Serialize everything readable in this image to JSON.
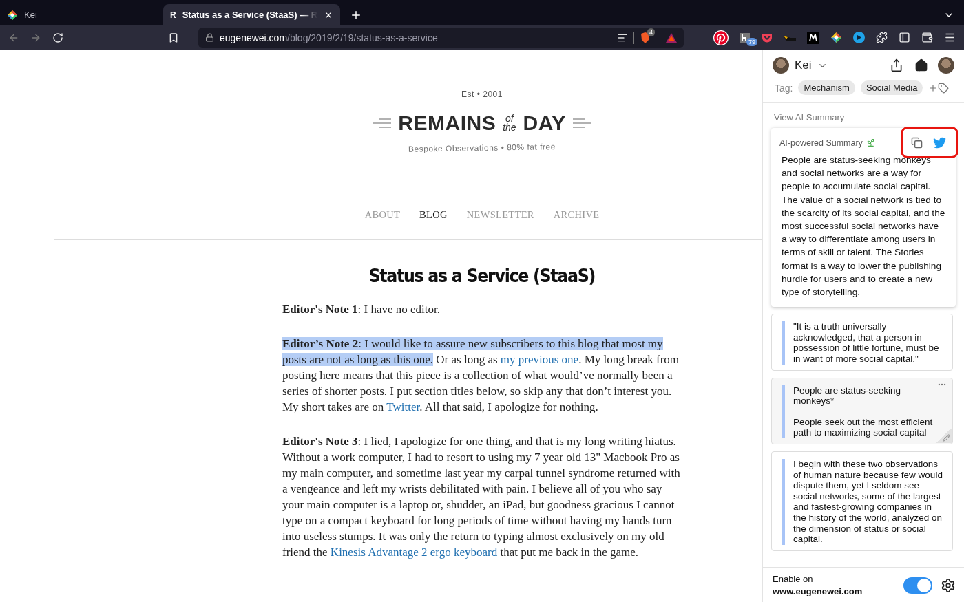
{
  "browser": {
    "tabs": [
      {
        "label": "Kei",
        "selected": false,
        "kind": "app"
      },
      {
        "label": "Status as a Service (StaaS) — R",
        "selected": true,
        "kind": "site",
        "favicon": "R"
      }
    ],
    "url": {
      "host": "eugenewei.com",
      "path": "/blog/2019/2/19/status-as-a-service"
    },
    "brave_badge": "4",
    "extension_badge": "79"
  },
  "site": {
    "established": "Est • 2001",
    "logo": {
      "word1": "REMAINS",
      "small_top": "of",
      "small_bottom": "the",
      "word2": "DAY"
    },
    "tagline": "Bespoke Observations • 80% fat free",
    "nav": [
      {
        "label": "ABOUT",
        "selected": false
      },
      {
        "label": "BLOG",
        "selected": true
      },
      {
        "label": "NEWSLETTER",
        "selected": false
      },
      {
        "label": "ARCHIVE",
        "selected": false
      }
    ]
  },
  "article": {
    "title": "Status as a Service (StaaS)",
    "paragraphs": [
      [
        {
          "kind": "bold",
          "text": "Editor's Note 1"
        },
        {
          "kind": "plain",
          "text": ": I have no editor."
        }
      ],
      [
        {
          "kind": "bold_highlight",
          "text": "Editor’s Note 2"
        },
        {
          "kind": "highlight",
          "text": ": I would like to assure new subscribers to this blog that most my posts are not as long as this one."
        },
        {
          "kind": "plain",
          "text": " Or as long as "
        },
        {
          "kind": "link",
          "text": "my previous one"
        },
        {
          "kind": "plain",
          "text": ". My long break from posting here means that this piece is a collection of what would’ve normally been a series of shorter posts. I put section titles below, so skip any that don’t interest you. My short takes are on "
        },
        {
          "kind": "link",
          "text": "Twitter"
        },
        {
          "kind": "plain",
          "text": ". All that said, I apologize for nothing."
        }
      ],
      [
        {
          "kind": "bold",
          "text": "Editor's Note 3"
        },
        {
          "kind": "plain",
          "text": ": I lied, I apologize for one thing, and that is my long writing hiatus. Without a work computer, I had to resort to using my 7 year old 13\" Macbook Pro as my main computer, and sometime last year my carpal tunnel syndrome returned with a vengeance and left my wrists debilitated with pain. I believe all of you who say your main computer is a laptop or, shudder, an iPad, but goodness gracious I cannot type on a compact keyboard for long periods of time without having my hands turn into useless stumps. It was only the return to typing almost exclusively on my old friend the "
        },
        {
          "kind": "link",
          "text": "Kinesis Advantage 2 ergo keyboard"
        },
        {
          "kind": "plain",
          "text": " that put me back in the game."
        }
      ]
    ]
  },
  "panel": {
    "user": "Kei",
    "tag_label": "Tag:",
    "tags": [
      "Mechanism",
      "Social Media"
    ],
    "view_summary": "View AI Summary",
    "summary": {
      "title": "AI-powered Summary",
      "text": "People are status-seeking monkeys and social networks are a way for people to accumulate social capital. The value of a social network is tied to the scarcity of its social capital, and the most successful social networks have a way to differentiate among users in terms of skill or talent. The Stories format is a way to lower the publishing hurdle for users and to create a new type of storytelling."
    },
    "highlights": [
      {
        "text": "\"It is a truth universally acknowledged, that a person in possession of little fortune, must be in want of more social capital.\"",
        "hovered": false,
        "color": "#a8c4f7"
      },
      {
        "text": "People are status-seeking monkeys*",
        "note": "People seek out the most efficient path to maximizing social capital",
        "hovered": true,
        "color": "#a8c4f7"
      },
      {
        "text": "I begin with these two observations of human nature because few would dispute them, yet I seldom see social networks, some of the largest and fastest-growing companies in the history of the world, analyzed on the dimension of status or social capital.",
        "hovered": false,
        "color": "#a8c4f7"
      }
    ],
    "enable_label": "Enable on",
    "enable_site": "www.eugenewei.com",
    "enabled": true
  }
}
